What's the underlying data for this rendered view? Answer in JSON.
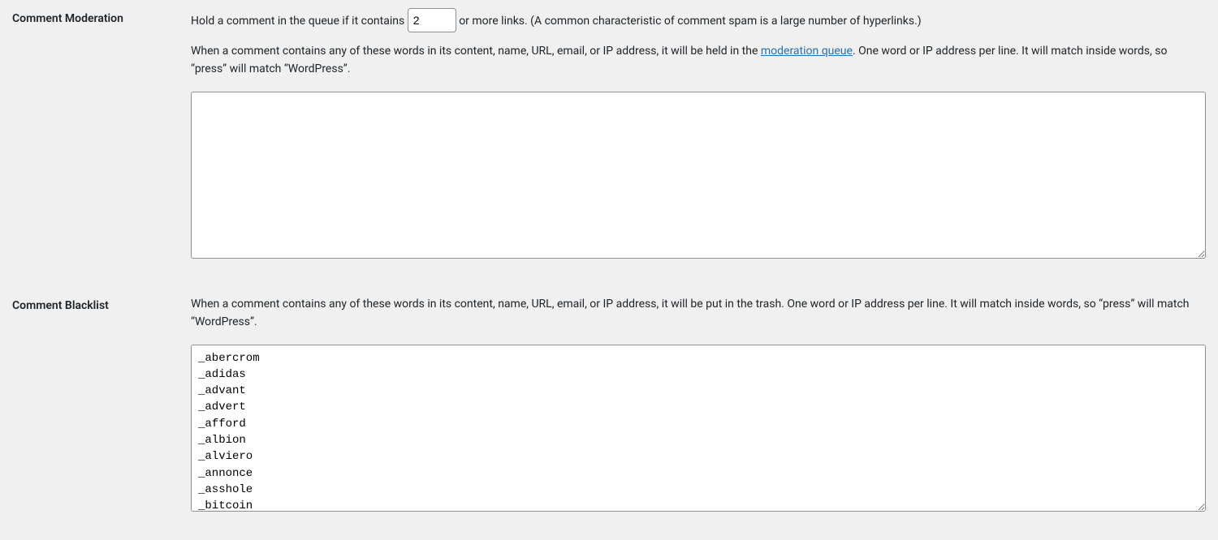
{
  "moderation": {
    "section_label": "Comment Moderation",
    "hold_prefix": "Hold a comment in the queue if it contains ",
    "links_count": "2",
    "hold_suffix": " or more links. (A common characteristic of comment spam is a large number of hyperlinks.)",
    "keys_desc_a": "When a comment contains any of these words in its content, name, URL, email, or IP address, it will be held in the ",
    "keys_link_text": "moderation queue",
    "keys_desc_b": ". One word or IP address per line. It will match inside words, so “press” will match “WordPress”.",
    "textarea_value": ""
  },
  "blacklist": {
    "section_label": "Comment Blacklist",
    "desc": "When a comment contains any of these words in its content, name, URL, email, or IP address, it will be put in the trash. One word or IP address per line. It will match inside words, so “press” will match “WordPress”.",
    "textarea_value": "_abercrom\n_adidas\n_advant\n_advert\n_afford\n_albion\n_alviero\n_annonce\n_asshole\n_bitcoin"
  }
}
